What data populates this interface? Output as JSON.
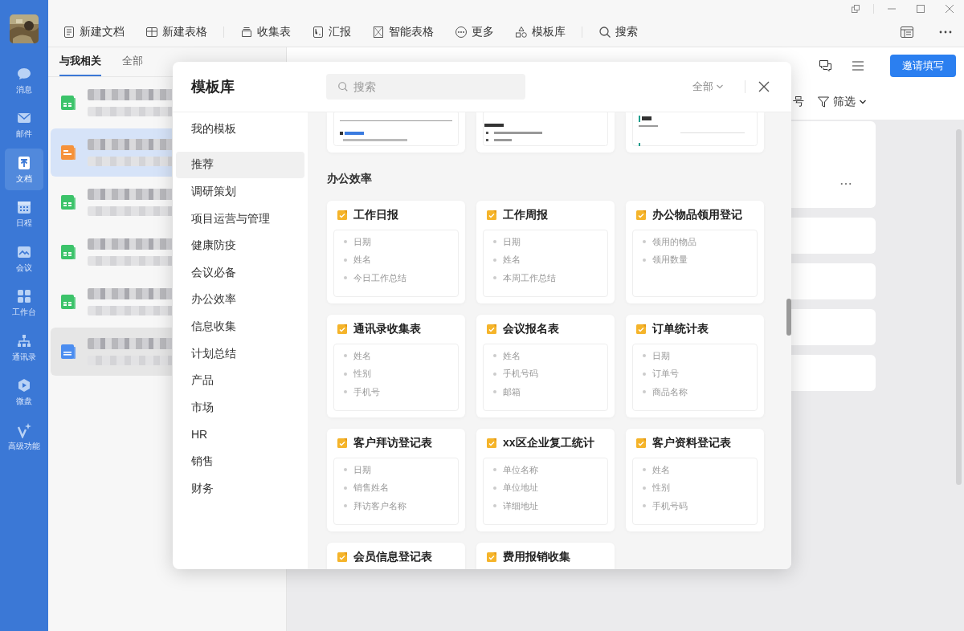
{
  "sidebar": {
    "items": [
      {
        "label": "消息",
        "selected": false
      },
      {
        "label": "邮件",
        "selected": false
      },
      {
        "label": "文档",
        "selected": true
      },
      {
        "label": "日程",
        "selected": false
      },
      {
        "label": "会议",
        "selected": false
      },
      {
        "label": "工作台",
        "selected": false
      },
      {
        "label": "通讯录",
        "selected": false
      },
      {
        "label": "微盘",
        "selected": false
      },
      {
        "label": "高级功能",
        "selected": false
      }
    ]
  },
  "toolbar": {
    "items": [
      "新建文档",
      "新建表格",
      "收集表",
      "汇报",
      "智能表格",
      "更多",
      "模板库",
      "搜索"
    ]
  },
  "file_list": {
    "tabs": [
      {
        "label": "与我相关",
        "selected": true
      },
      {
        "label": "全部",
        "selected": false
      }
    ],
    "rows": [
      {
        "kind": "sheet",
        "selected": false,
        "hovered": false
      },
      {
        "kind": "slides",
        "selected": true,
        "hovered": false
      },
      {
        "kind": "sheet",
        "selected": false,
        "hovered": false
      },
      {
        "kind": "sheet",
        "selected": false,
        "hovered": false
      },
      {
        "kind": "sheet",
        "selected": false,
        "hovered": false
      },
      {
        "kind": "doc",
        "selected": false,
        "hovered": true
      }
    ]
  },
  "detail": {
    "invite_button": "邀请填写",
    "partial_label": "号",
    "filter": "筛选",
    "cards": [
      {
        "kind": "tall"
      },
      {
        "kind": "short"
      },
      {
        "kind": "short"
      },
      {
        "kind": "short"
      },
      {
        "kind": "short"
      }
    ]
  },
  "modal": {
    "title": "模板库",
    "search": {
      "placeholder": "搜索"
    },
    "scope": "全部",
    "categories": [
      {
        "label": "我的模板",
        "selected": false
      },
      {
        "label": "推荐",
        "selected": true
      },
      {
        "label": "调研策划",
        "selected": false
      },
      {
        "label": "项目运营与管理",
        "selected": false
      },
      {
        "label": "健康防疫",
        "selected": false
      },
      {
        "label": "会议必备",
        "selected": false
      },
      {
        "label": "办公效率",
        "selected": false
      },
      {
        "label": "信息收集",
        "selected": false
      },
      {
        "label": "计划总结",
        "selected": false
      },
      {
        "label": "产品",
        "selected": false
      },
      {
        "label": "市场",
        "selected": false
      },
      {
        "label": "HR",
        "selected": false
      },
      {
        "label": "销售",
        "selected": false
      },
      {
        "label": "财务",
        "selected": false
      }
    ],
    "previews": [
      {
        "kind": "agenda"
      },
      {
        "kind": "numbered"
      },
      {
        "kind": "summary"
      }
    ],
    "section_title": "办公效率",
    "templates": [
      {
        "title": "工作日报",
        "fields": [
          "日期",
          "姓名",
          "今日工作总结"
        ]
      },
      {
        "title": "工作周报",
        "fields": [
          "日期",
          "姓名",
          "本周工作总结"
        ]
      },
      {
        "title": "办公物品领用登记",
        "fields": [
          "领用的物品",
          "领用数量"
        ]
      },
      {
        "title": "通讯录收集表",
        "fields": [
          "姓名",
          "性别",
          "手机号"
        ]
      },
      {
        "title": "会议报名表",
        "fields": [
          "姓名",
          "手机号码",
          "邮箱"
        ]
      },
      {
        "title": "订单统计表",
        "fields": [
          "日期",
          "订单号",
          "商品名称"
        ]
      },
      {
        "title": "客户拜访登记表",
        "fields": [
          "日期",
          "销售姓名",
          "拜访客户名称"
        ]
      },
      {
        "title": "xx区企业复工统计",
        "fields": [
          "单位名称",
          "单位地址",
          "详细地址"
        ]
      },
      {
        "title": "客户资料登记表",
        "fields": [
          "姓名",
          "性别",
          "手机号码"
        ]
      },
      {
        "title": "会员信息登记表"
      },
      {
        "title": "费用报销收集"
      }
    ]
  }
}
